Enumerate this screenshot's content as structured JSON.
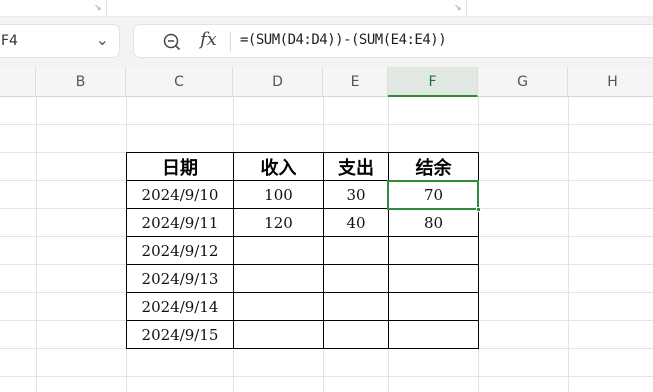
{
  "namebox": {
    "value": "F4"
  },
  "formula_bar": {
    "formula": "=(SUM(D4:D4))-(SUM(E4:E4))"
  },
  "columns": [
    {
      "label": "B",
      "active": false
    },
    {
      "label": "C",
      "active": false
    },
    {
      "label": "D",
      "active": false
    },
    {
      "label": "E",
      "active": false
    },
    {
      "label": "F",
      "active": true
    },
    {
      "label": "G",
      "active": false
    },
    {
      "label": "H",
      "active": false
    }
  ],
  "table": {
    "headers": [
      "日期",
      "收入",
      "支出",
      "结余"
    ],
    "rows": [
      [
        "2024/9/10",
        "100",
        "30",
        "70"
      ],
      [
        "2024/9/11",
        "120",
        "40",
        "80"
      ],
      [
        "2024/9/12",
        "",
        "",
        ""
      ],
      [
        "2024/9/13",
        "",
        "",
        ""
      ],
      [
        "2024/9/14",
        "",
        "",
        ""
      ],
      [
        "2024/9/15",
        "",
        "",
        ""
      ]
    ]
  },
  "selection": {
    "cell": "F4"
  },
  "colors": {
    "accent": "#2e8b3e",
    "gridline": "#e3e3e3",
    "border": "#000000"
  }
}
